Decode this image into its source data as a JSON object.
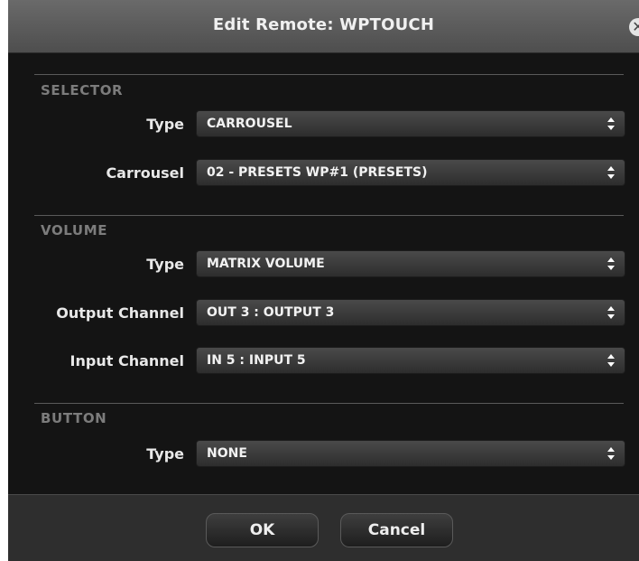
{
  "dialog": {
    "title": "Edit Remote: WPTOUCH",
    "close_icon": "close-icon"
  },
  "sections": {
    "selector": {
      "label": "SELECTOR",
      "type_label": "Type",
      "type_value": "CARROUSEL",
      "carrousel_label": "Carrousel",
      "carrousel_value": "02 - PRESETS WP#1 (PRESETS)"
    },
    "volume": {
      "label": "VOLUME",
      "type_label": "Type",
      "type_value": "MATRIX VOLUME",
      "output_label": "Output Channel",
      "output_value": "OUT 3 : OUTPUT 3",
      "input_label": "Input Channel",
      "input_value": "IN 5 : INPUT 5"
    },
    "button": {
      "label": "BUTTON",
      "type_label": "Type",
      "type_value": "NONE"
    }
  },
  "footer": {
    "ok_label": "OK",
    "cancel_label": "Cancel"
  },
  "icons": {
    "select_arrows": "up-down-arrows-icon"
  }
}
